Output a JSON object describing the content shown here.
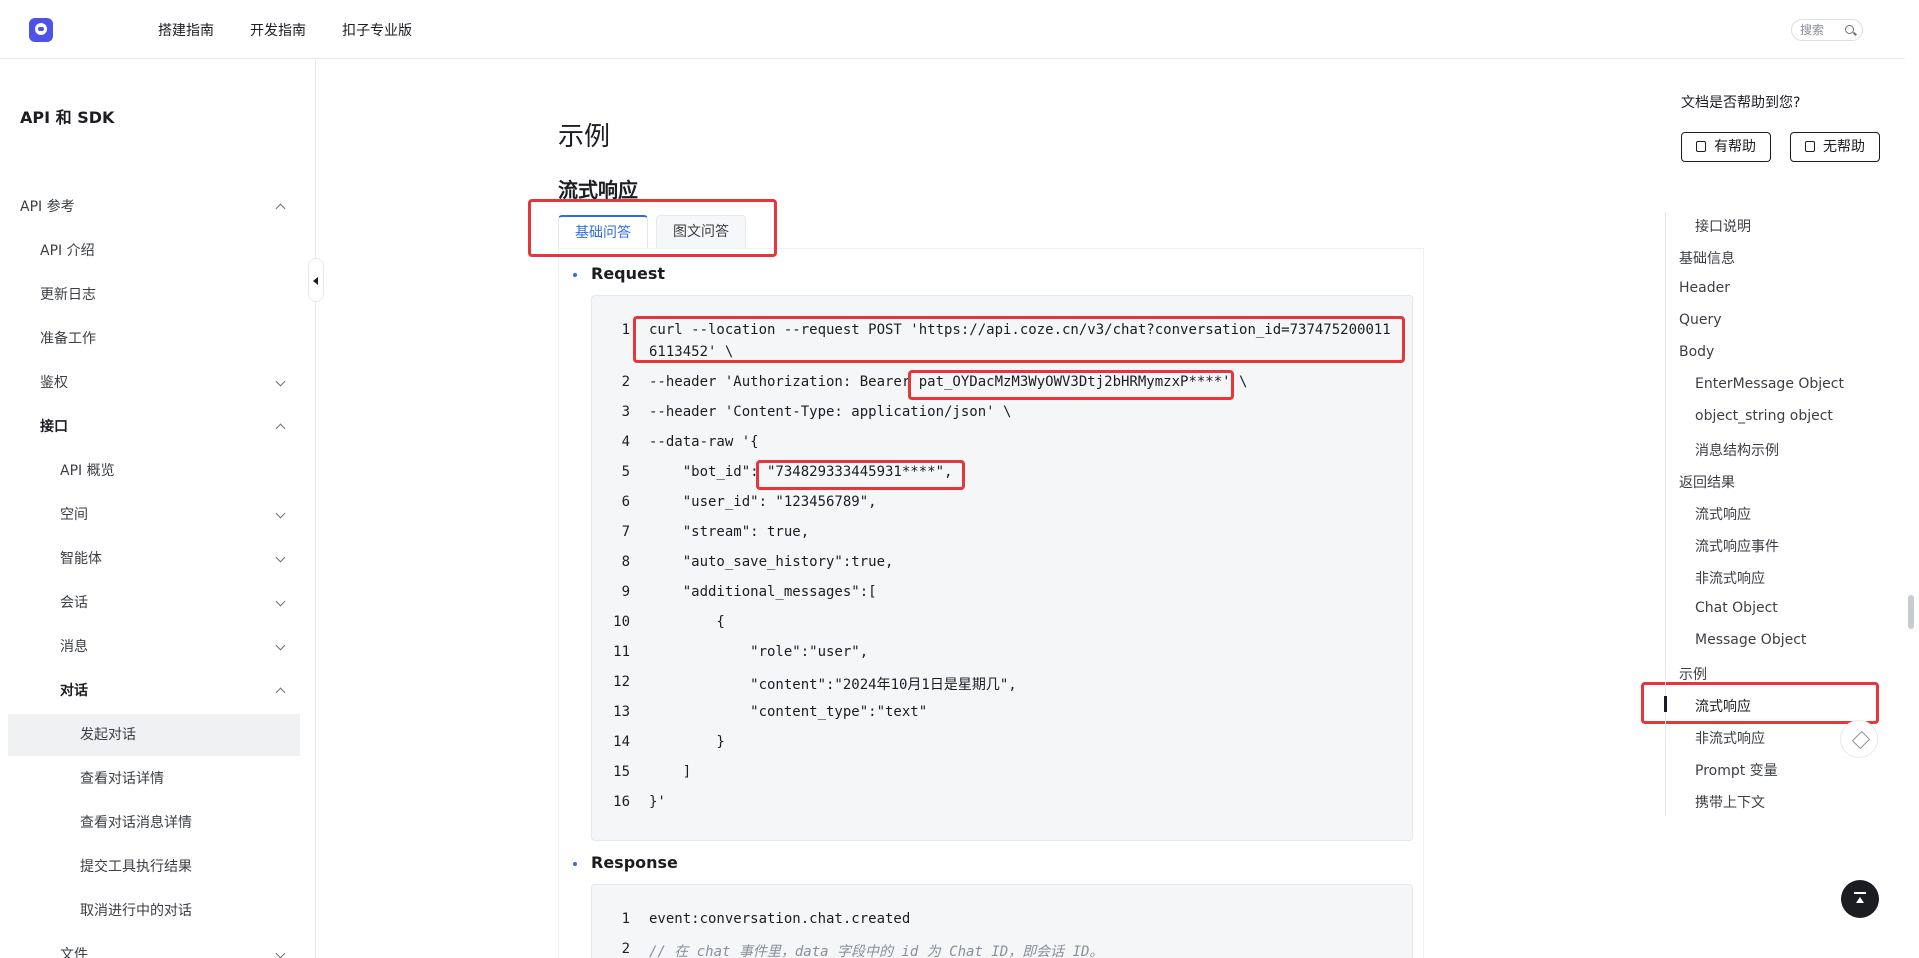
{
  "topnav": {
    "items": [
      "搭建指南",
      "开发指南",
      "扣子专业版"
    ],
    "search_placeholder": "搜索"
  },
  "sidebar": {
    "title": "API 和 SDK",
    "items": [
      {
        "label": "API 参考",
        "expanded": true
      },
      {
        "label": "API 介绍"
      },
      {
        "label": "更新日志"
      },
      {
        "label": "准备工作"
      },
      {
        "label": "鉴权",
        "expanded": false
      },
      {
        "label": "接口",
        "expanded": true
      },
      {
        "label": "API 概览"
      },
      {
        "label": "空间",
        "expanded": false
      },
      {
        "label": "智能体",
        "expanded": false
      },
      {
        "label": "会话",
        "expanded": false
      },
      {
        "label": "消息",
        "expanded": false
      },
      {
        "label": "对话",
        "expanded": true
      },
      {
        "label": "发起对话",
        "active": true
      },
      {
        "label": "查看对话详情"
      },
      {
        "label": "查看对话消息详情"
      },
      {
        "label": "提交工具执行结果"
      },
      {
        "label": "取消进行中的对话"
      },
      {
        "label": "文件",
        "expanded": false
      }
    ]
  },
  "main": {
    "heading": "示例",
    "subheading": "流式响应",
    "tabs": [
      {
        "label": "基础问答",
        "active": true
      },
      {
        "label": "图文问答"
      }
    ],
    "request_label": "Request",
    "response_label": "Response",
    "request_code": [
      "curl --location --request POST 'https://api.coze.cn/v3/chat?conversation_id=737475200011",
      "6113452' \\",
      "--header 'Authorization: Bearer pat_OYDacMzM3WyOWV3Dtj2bHRMymzxP****' \\",
      "--header 'Content-Type: application/json' \\",
      "--data-raw '{",
      "    \"bot_id\": \"734829333445931****\",",
      "    \"user_id\": \"123456789\",",
      "    \"stream\": true,",
      "    \"auto_save_history\":true,",
      "    \"additional_messages\":[",
      "        {",
      "            \"role\":\"user\",",
      "            \"content\":\"2024年10月1日是星期几\",",
      "            \"content_type\":\"text\"",
      "        }",
      "    ]",
      "}'"
    ],
    "response_code": [
      "event:conversation.chat.created",
      "// 在 chat 事件里，data 字段中的 id 为 Chat ID，即会话 ID。"
    ]
  },
  "feedback": {
    "question": "文档是否帮助到您?",
    "yes": "有帮助",
    "no": "无帮助"
  },
  "toc": [
    {
      "label": "接口说明",
      "level": 2
    },
    {
      "label": "基础信息",
      "level": 1
    },
    {
      "label": "Header",
      "level": 1
    },
    {
      "label": "Query",
      "level": 1
    },
    {
      "label": "Body",
      "level": 1
    },
    {
      "label": "EnterMessage Object",
      "level": 2
    },
    {
      "label": "object_string object",
      "level": 2
    },
    {
      "label": "消息结构示例",
      "level": 2
    },
    {
      "label": "返回结果",
      "level": 1
    },
    {
      "label": "流式响应",
      "level": 2
    },
    {
      "label": "流式响应事件",
      "level": 2
    },
    {
      "label": "非流式响应",
      "level": 2
    },
    {
      "label": "Chat Object",
      "level": 2
    },
    {
      "label": "Message Object",
      "level": 2
    },
    {
      "label": "示例",
      "level": 1
    },
    {
      "label": "流式响应",
      "level": 2,
      "active": true
    },
    {
      "label": "非流式响应",
      "level": 2
    },
    {
      "label": "Prompt 变量",
      "level": 2
    },
    {
      "label": "携带上下文",
      "level": 2
    }
  ],
  "icons": [
    "logo-icon",
    "search-icon",
    "thumbs-up-icon",
    "thumbs-down-icon",
    "edit-icon",
    "back-to-top-icon"
  ],
  "colors": {
    "accent": "#2e6de6",
    "annotation": "#e5373a",
    "brand": "#4d53e8"
  }
}
